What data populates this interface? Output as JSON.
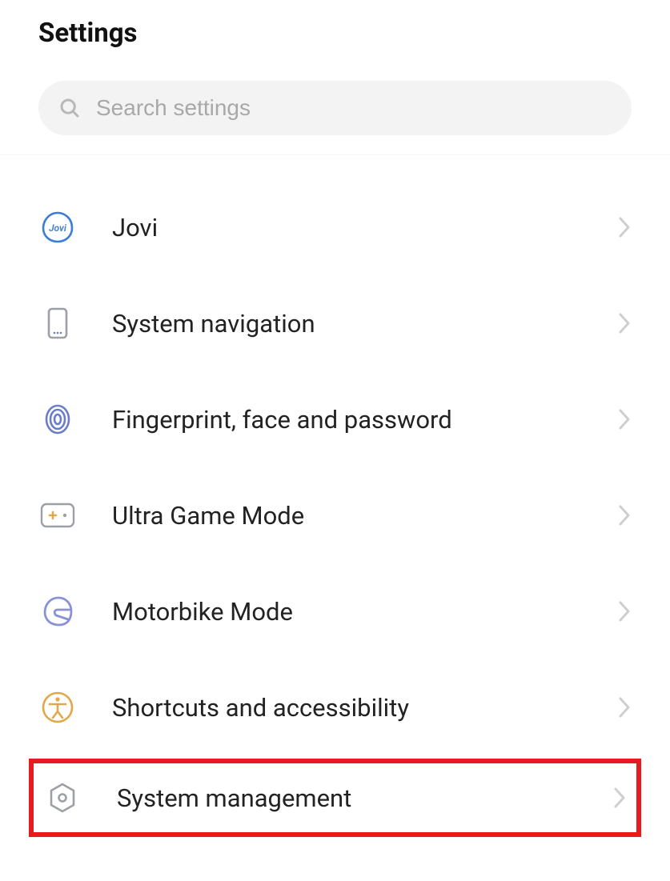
{
  "header": {
    "title": "Settings"
  },
  "search": {
    "placeholder": "Search settings"
  },
  "rows": [
    {
      "icon": "jovi",
      "label": "Jovi"
    },
    {
      "icon": "phone-nav",
      "label": "System navigation"
    },
    {
      "icon": "fingerprint",
      "label": "Fingerprint, face and password"
    },
    {
      "icon": "gamepad",
      "label": "Ultra Game Mode"
    },
    {
      "icon": "helmet",
      "label": "Motorbike Mode"
    },
    {
      "icon": "accessibility",
      "label": "Shortcuts and accessibility"
    },
    {
      "icon": "gear-hex",
      "label": "System management"
    }
  ],
  "highlighted_index": 6
}
